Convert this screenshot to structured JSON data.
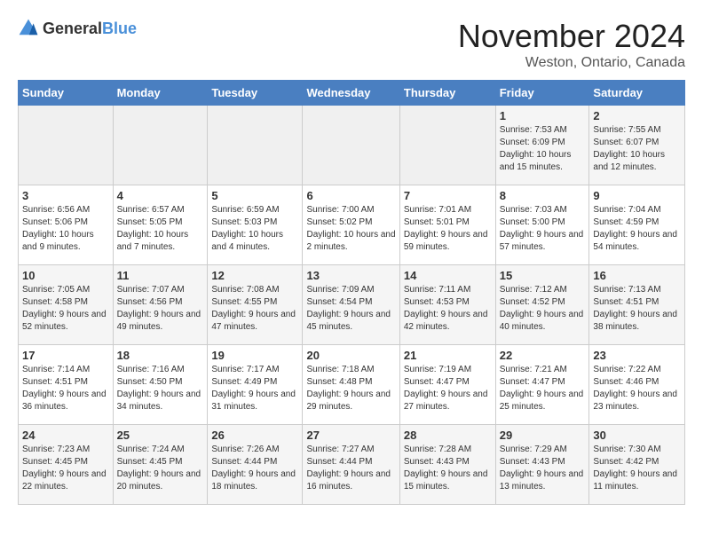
{
  "header": {
    "logo_general": "General",
    "logo_blue": "Blue",
    "month": "November 2024",
    "location": "Weston, Ontario, Canada"
  },
  "weekdays": [
    "Sunday",
    "Monday",
    "Tuesday",
    "Wednesday",
    "Thursday",
    "Friday",
    "Saturday"
  ],
  "weeks": [
    [
      {
        "day": "",
        "info": ""
      },
      {
        "day": "",
        "info": ""
      },
      {
        "day": "",
        "info": ""
      },
      {
        "day": "",
        "info": ""
      },
      {
        "day": "",
        "info": ""
      },
      {
        "day": "1",
        "info": "Sunrise: 7:53 AM\nSunset: 6:09 PM\nDaylight: 10 hours and 15 minutes."
      },
      {
        "day": "2",
        "info": "Sunrise: 7:55 AM\nSunset: 6:07 PM\nDaylight: 10 hours and 12 minutes."
      }
    ],
    [
      {
        "day": "3",
        "info": "Sunrise: 6:56 AM\nSunset: 5:06 PM\nDaylight: 10 hours and 9 minutes."
      },
      {
        "day": "4",
        "info": "Sunrise: 6:57 AM\nSunset: 5:05 PM\nDaylight: 10 hours and 7 minutes."
      },
      {
        "day": "5",
        "info": "Sunrise: 6:59 AM\nSunset: 5:03 PM\nDaylight: 10 hours and 4 minutes."
      },
      {
        "day": "6",
        "info": "Sunrise: 7:00 AM\nSunset: 5:02 PM\nDaylight: 10 hours and 2 minutes."
      },
      {
        "day": "7",
        "info": "Sunrise: 7:01 AM\nSunset: 5:01 PM\nDaylight: 9 hours and 59 minutes."
      },
      {
        "day": "8",
        "info": "Sunrise: 7:03 AM\nSunset: 5:00 PM\nDaylight: 9 hours and 57 minutes."
      },
      {
        "day": "9",
        "info": "Sunrise: 7:04 AM\nSunset: 4:59 PM\nDaylight: 9 hours and 54 minutes."
      }
    ],
    [
      {
        "day": "10",
        "info": "Sunrise: 7:05 AM\nSunset: 4:58 PM\nDaylight: 9 hours and 52 minutes."
      },
      {
        "day": "11",
        "info": "Sunrise: 7:07 AM\nSunset: 4:56 PM\nDaylight: 9 hours and 49 minutes."
      },
      {
        "day": "12",
        "info": "Sunrise: 7:08 AM\nSunset: 4:55 PM\nDaylight: 9 hours and 47 minutes."
      },
      {
        "day": "13",
        "info": "Sunrise: 7:09 AM\nSunset: 4:54 PM\nDaylight: 9 hours and 45 minutes."
      },
      {
        "day": "14",
        "info": "Sunrise: 7:11 AM\nSunset: 4:53 PM\nDaylight: 9 hours and 42 minutes."
      },
      {
        "day": "15",
        "info": "Sunrise: 7:12 AM\nSunset: 4:52 PM\nDaylight: 9 hours and 40 minutes."
      },
      {
        "day": "16",
        "info": "Sunrise: 7:13 AM\nSunset: 4:51 PM\nDaylight: 9 hours and 38 minutes."
      }
    ],
    [
      {
        "day": "17",
        "info": "Sunrise: 7:14 AM\nSunset: 4:51 PM\nDaylight: 9 hours and 36 minutes."
      },
      {
        "day": "18",
        "info": "Sunrise: 7:16 AM\nSunset: 4:50 PM\nDaylight: 9 hours and 34 minutes."
      },
      {
        "day": "19",
        "info": "Sunrise: 7:17 AM\nSunset: 4:49 PM\nDaylight: 9 hours and 31 minutes."
      },
      {
        "day": "20",
        "info": "Sunrise: 7:18 AM\nSunset: 4:48 PM\nDaylight: 9 hours and 29 minutes."
      },
      {
        "day": "21",
        "info": "Sunrise: 7:19 AM\nSunset: 4:47 PM\nDaylight: 9 hours and 27 minutes."
      },
      {
        "day": "22",
        "info": "Sunrise: 7:21 AM\nSunset: 4:47 PM\nDaylight: 9 hours and 25 minutes."
      },
      {
        "day": "23",
        "info": "Sunrise: 7:22 AM\nSunset: 4:46 PM\nDaylight: 9 hours and 23 minutes."
      }
    ],
    [
      {
        "day": "24",
        "info": "Sunrise: 7:23 AM\nSunset: 4:45 PM\nDaylight: 9 hours and 22 minutes."
      },
      {
        "day": "25",
        "info": "Sunrise: 7:24 AM\nSunset: 4:45 PM\nDaylight: 9 hours and 20 minutes."
      },
      {
        "day": "26",
        "info": "Sunrise: 7:26 AM\nSunset: 4:44 PM\nDaylight: 9 hours and 18 minutes."
      },
      {
        "day": "27",
        "info": "Sunrise: 7:27 AM\nSunset: 4:44 PM\nDaylight: 9 hours and 16 minutes."
      },
      {
        "day": "28",
        "info": "Sunrise: 7:28 AM\nSunset: 4:43 PM\nDaylight: 9 hours and 15 minutes."
      },
      {
        "day": "29",
        "info": "Sunrise: 7:29 AM\nSunset: 4:43 PM\nDaylight: 9 hours and 13 minutes."
      },
      {
        "day": "30",
        "info": "Sunrise: 7:30 AM\nSunset: 4:42 PM\nDaylight: 9 hours and 11 minutes."
      }
    ]
  ]
}
